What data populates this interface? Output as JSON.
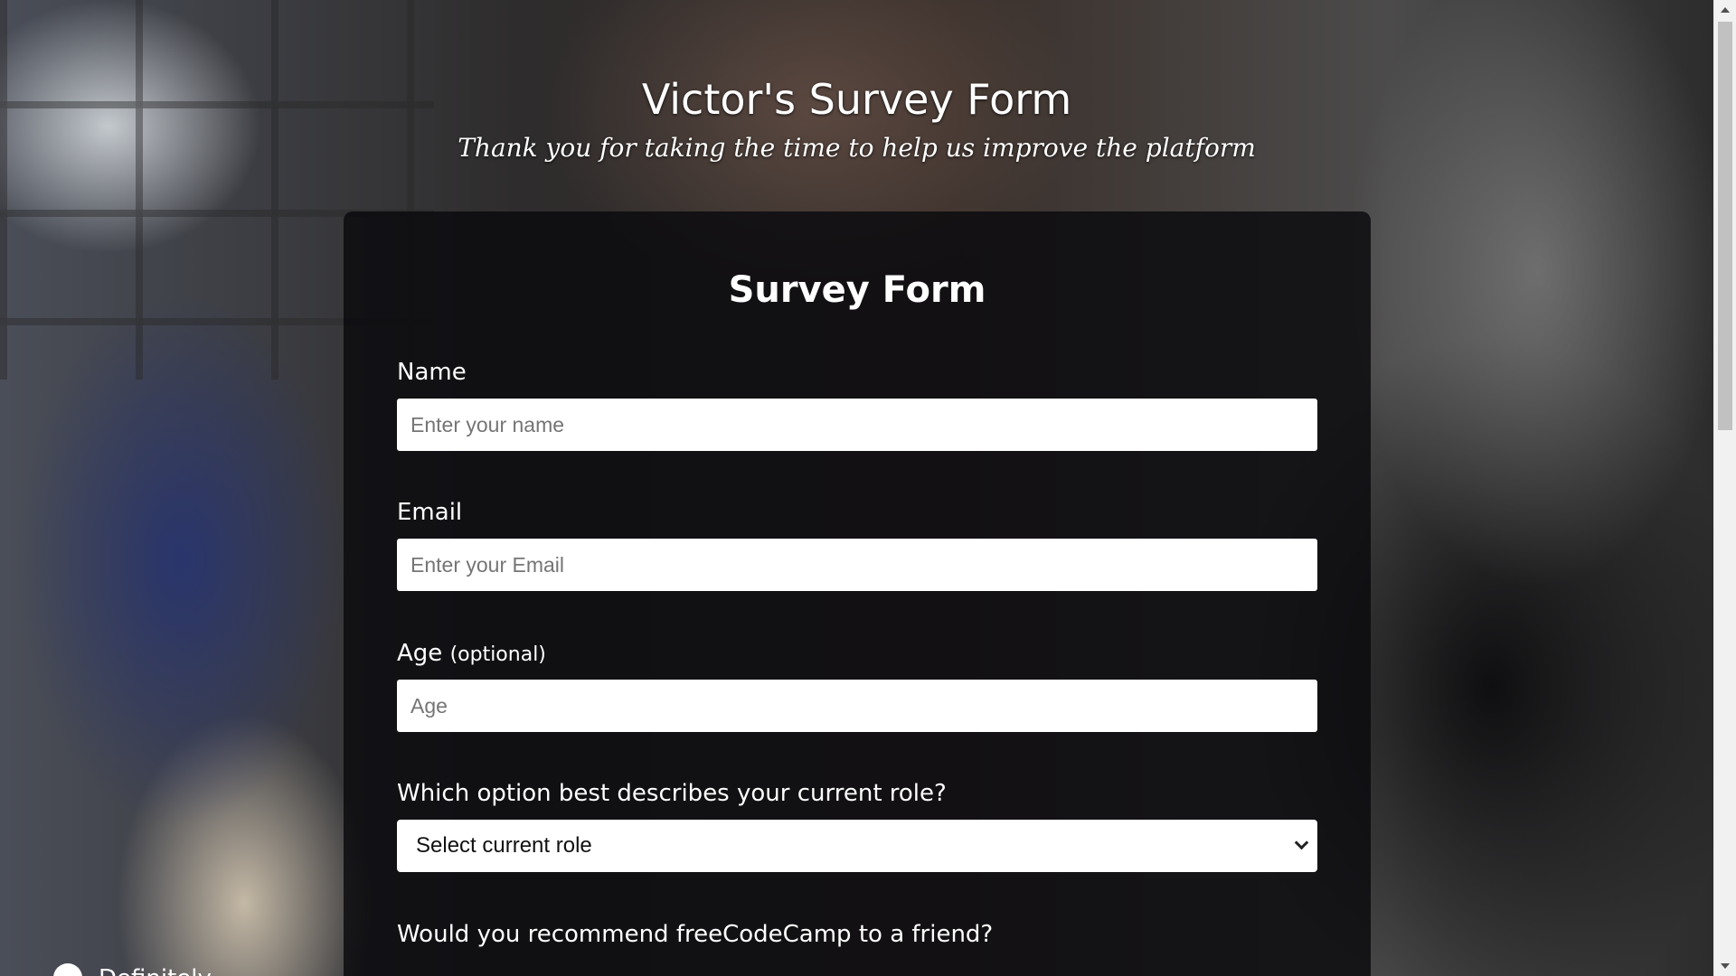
{
  "header": {
    "title": "Victor's Survey Form",
    "subtitle": "Thank you for taking the time to help us improve the platform"
  },
  "form": {
    "heading": "Survey Form",
    "name": {
      "label": "Name",
      "placeholder": "Enter your name",
      "value": ""
    },
    "email": {
      "label": "Email",
      "placeholder": "Enter your Email",
      "value": ""
    },
    "age": {
      "label": "Age",
      "optional_note": "(optional)",
      "placeholder": "Age",
      "value": ""
    },
    "role": {
      "label": "Which option best describes your current role?",
      "selected": "Select current role"
    },
    "recommend": {
      "label": "Would you recommend freeCodeCamp to a friend?",
      "first_option": "Definitely"
    }
  },
  "colors": {
    "card_background": "#0a0a0e",
    "text": "#ffffff",
    "input_background": "#ffffff",
    "placeholder": "#757575"
  },
  "icons": {
    "select_arrow": "chevron-down-icon",
    "scroll_up": "scroll-up-arrow-icon",
    "scroll_down": "scroll-down-arrow-icon"
  }
}
